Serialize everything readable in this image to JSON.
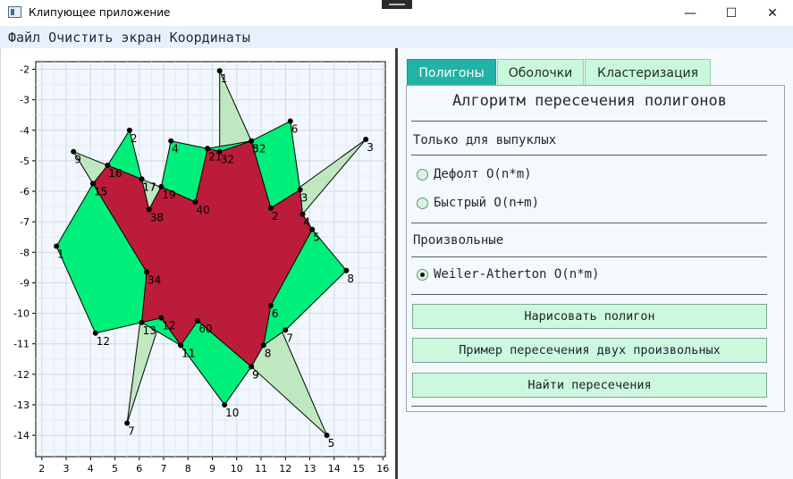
{
  "window": {
    "title": "Клипующее приложение",
    "minimize_glyph": "—",
    "maximize_glyph": "☐",
    "close_glyph": "✕"
  },
  "menu": [
    "Файл",
    "Очистить экран",
    "Координаты"
  ],
  "tabs": [
    {
      "label": "Полигоны",
      "active": true
    },
    {
      "label": "Оболочки",
      "active": false
    },
    {
      "label": "Кластеризация",
      "active": false
    }
  ],
  "panel": {
    "title": "Алгоритм пересечения полигонов",
    "convex_label": "Только для выпуклых",
    "convex_options": [
      {
        "label": "Дефолт O(n*m)",
        "checked": false
      },
      {
        "label": "Быстрый O(n+m)",
        "checked": false
      }
    ],
    "arbitrary_label": "Произвольные",
    "arbitrary_options": [
      {
        "label": "Weiler-Atherton O(n*m)",
        "checked": true
      }
    ],
    "buttons": [
      "Нарисовать полигон",
      "Пример пересечения двух произвольных",
      "Найти пересечения"
    ]
  },
  "colors": {
    "polygon_a": "#00ee7a",
    "polygon_b": "#bfe8c1",
    "intersection": "#bb1c3a",
    "tab_active": "#20b3a6",
    "button_bg": "#cdf8e0"
  },
  "chart_data": {
    "type": "scatter",
    "x_ticks": [
      2,
      3,
      4,
      5,
      6,
      7,
      8,
      9,
      10,
      11,
      12,
      13,
      14,
      15,
      16
    ],
    "y_ticks": [
      -2,
      -3,
      -4,
      -5,
      -6,
      -7,
      -8,
      -9,
      -10,
      -11,
      -12,
      -13,
      -14
    ],
    "xlim": [
      1.75,
      16.1
    ],
    "ylim": [
      -14.7,
      -1.75
    ],
    "grid": true,
    "polygon_a": {
      "color": "#00ee7a",
      "points": [
        {
          "x": 2.6,
          "y": -7.8,
          "label": "1"
        },
        {
          "x": 4.1,
          "y": -5.75,
          "label": "15"
        },
        {
          "x": 4.7,
          "y": -5.15,
          "label": "16"
        },
        {
          "x": 5.6,
          "y": -4.0,
          "label": "2"
        },
        {
          "x": 6.1,
          "y": -5.6,
          "label": "17"
        },
        {
          "x": 6.4,
          "y": -6.6,
          "label": "38"
        },
        {
          "x": 6.9,
          "y": -5.85,
          "label": "19"
        },
        {
          "x": 7.3,
          "y": -4.35,
          "label": "4"
        },
        {
          "x": 8.8,
          "y": -4.6,
          "label": "21"
        },
        {
          "x": 10.6,
          "y": -4.35,
          "label": "5"
        },
        {
          "x": 12.2,
          "y": -3.7,
          "label": "6"
        },
        {
          "x": 12.6,
          "y": -5.95,
          "label": "3"
        },
        {
          "x": 12.7,
          "y": -6.75,
          "label": "4"
        },
        {
          "x": 13.1,
          "y": -7.25,
          "label": "5"
        },
        {
          "x": 14.5,
          "y": -8.6,
          "label": "8"
        },
        {
          "x": 12.0,
          "y": -10.55,
          "label": "7"
        },
        {
          "x": 11.1,
          "y": -11.05,
          "label": "8"
        },
        {
          "x": 10.6,
          "y": -11.75,
          "label": "9"
        },
        {
          "x": 9.5,
          "y": -13.0,
          "label": "10"
        },
        {
          "x": 7.7,
          "y": -11.05,
          "label": "11"
        },
        {
          "x": 6.1,
          "y": -10.3,
          "label": "13"
        },
        {
          "x": 4.2,
          "y": -10.65,
          "label": "12"
        }
      ]
    },
    "polygon_b": {
      "color": "#bfe8c1",
      "points": [
        {
          "x": 9.3,
          "y": -2.05,
          "label": "1"
        },
        {
          "x": 10.6,
          "y": -4.35,
          "label": "32"
        },
        {
          "x": 11.4,
          "y": -6.55,
          "label": "2"
        },
        {
          "x": 15.3,
          "y": -4.3,
          "label": "3"
        },
        {
          "x": 12.7,
          "y": -6.75,
          "label": "4"
        },
        {
          "x": 11.4,
          "y": -9.75,
          "label": "6"
        },
        {
          "x": 13.7,
          "y": -14.0,
          "label": "5"
        },
        {
          "x": 10.6,
          "y": -11.75,
          "label": "9"
        },
        {
          "x": 8.4,
          "y": -10.25,
          "label": "60"
        },
        {
          "x": 7.7,
          "y": -11.05,
          "label": "11"
        },
        {
          "x": 6.9,
          "y": -10.15,
          "label": "12"
        },
        {
          "x": 5.5,
          "y": -13.6,
          "label": "7"
        },
        {
          "x": 6.3,
          "y": -8.65,
          "label": "34"
        },
        {
          "x": 4.1,
          "y": -5.75,
          "label": "15"
        },
        {
          "x": 3.3,
          "y": -4.7,
          "label": "9"
        },
        {
          "x": 4.7,
          "y": -5.15,
          "label": "16"
        },
        {
          "x": 6.1,
          "y": -5.6,
          "label": "17"
        },
        {
          "x": 8.3,
          "y": -6.35,
          "label": "40"
        },
        {
          "x": 8.8,
          "y": -4.6,
          "label": "21"
        },
        {
          "x": 9.3,
          "y": -4.7,
          "label": "32"
        }
      ]
    },
    "intersection": {
      "color": "#bb1c3a",
      "points": [
        {
          "x": 4.1,
          "y": -5.75
        },
        {
          "x": 4.7,
          "y": -5.15
        },
        {
          "x": 6.1,
          "y": -5.6
        },
        {
          "x": 6.4,
          "y": -6.6
        },
        {
          "x": 6.9,
          "y": -5.85
        },
        {
          "x": 8.3,
          "y": -6.35
        },
        {
          "x": 8.8,
          "y": -4.6
        },
        {
          "x": 9.3,
          "y": -4.7
        },
        {
          "x": 10.6,
          "y": -4.35
        },
        {
          "x": 11.4,
          "y": -6.55
        },
        {
          "x": 12.6,
          "y": -5.95
        },
        {
          "x": 12.7,
          "y": -6.75
        },
        {
          "x": 13.1,
          "y": -7.25
        },
        {
          "x": 11.4,
          "y": -9.75
        },
        {
          "x": 11.1,
          "y": -11.05
        },
        {
          "x": 10.6,
          "y": -11.75
        },
        {
          "x": 8.4,
          "y": -10.25
        },
        {
          "x": 7.7,
          "y": -11.05
        },
        {
          "x": 6.9,
          "y": -10.15
        },
        {
          "x": 6.1,
          "y": -10.3
        },
        {
          "x": 6.3,
          "y": -8.65
        }
      ]
    }
  }
}
